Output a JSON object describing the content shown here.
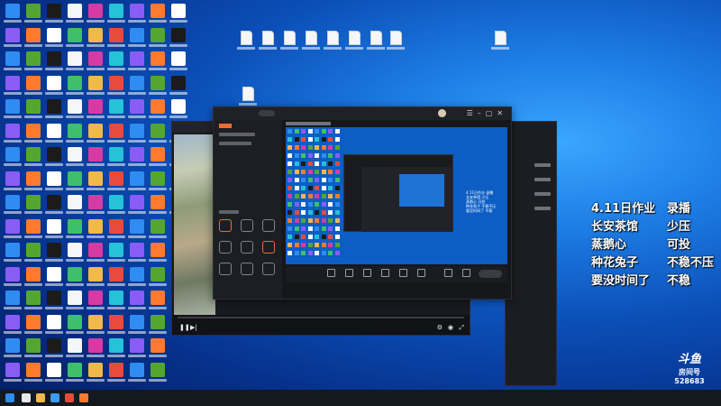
{
  "overlay": {
    "lines": [
      {
        "a": "4.11日作业",
        "b": "录播"
      },
      {
        "a": "长安茶馆",
        "b": "少压"
      },
      {
        "a": "蒸鹅心",
        "b": "可投"
      },
      {
        "a": "种花兔子",
        "b": "不稳不压"
      },
      {
        "a": "要没时间了",
        "b": "不稳"
      }
    ]
  },
  "douyu": {
    "logo": "斗鱼",
    "room_label": "房间号",
    "room_number": "528683"
  },
  "preview_text": [
    "4.11日作业 录播",
    "长安茶馆 少压",
    "蒸鹅心 可投",
    "种花兔子 不稳不压",
    "要没时间了 不稳"
  ],
  "colors": {
    "accent": "#f26a2e",
    "desktop_blue": "#0b4fb8"
  }
}
